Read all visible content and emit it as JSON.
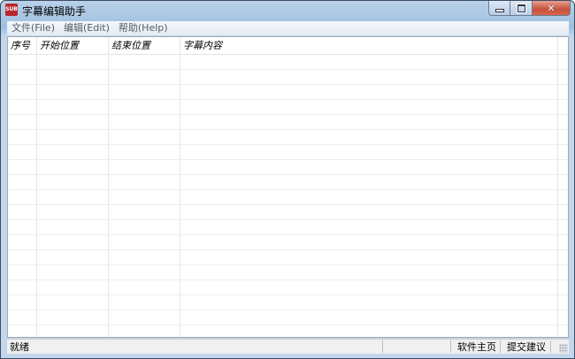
{
  "window": {
    "title": "字幕编辑助手",
    "icon": "app-logo-icon",
    "icon_text": "SUB"
  },
  "menu": [
    {
      "label": "文件(File)"
    },
    {
      "label": "编辑(Edit)"
    },
    {
      "label": "帮助(Help)"
    }
  ],
  "table": {
    "columns": [
      "序号",
      "开始位置",
      "结束位置",
      "字幕内容"
    ],
    "rows": []
  },
  "status": {
    "text": "就绪",
    "homepage": "软件主页",
    "feedback": "提交建议"
  },
  "colors": {
    "titlebar": "#a7c4e2",
    "close_button": "#c7503b",
    "grid_lines": "#eceef1"
  }
}
